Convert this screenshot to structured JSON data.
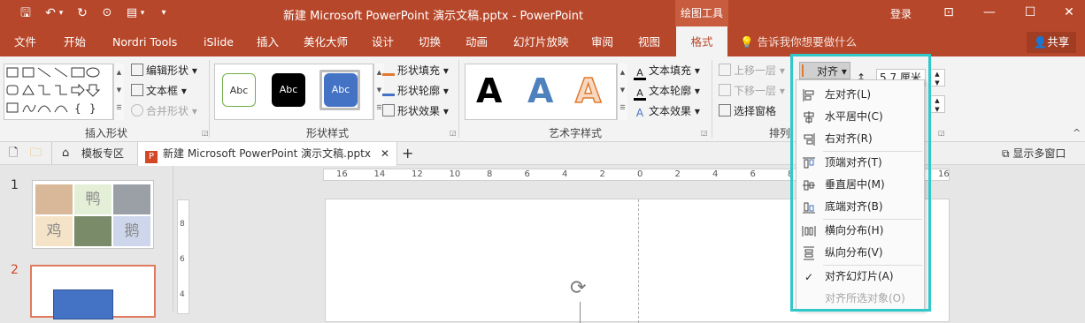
{
  "titlebar": {
    "doc_title": "新建 Microsoft PowerPoint 演示文稿.pptx  -  PowerPoint",
    "context_tab": "绘图工具",
    "login": "登录",
    "qat": {
      "save": "🖫",
      "undo": "↶",
      "redo": "↻",
      "more": "▾"
    }
  },
  "tabs": [
    "文件",
    "开始",
    "Nordri Tools",
    "iSlide",
    "插入",
    "美化大师",
    "设计",
    "切换",
    "动画",
    "幻灯片放映",
    "审阅",
    "视图",
    "格式"
  ],
  "tellme": "告诉我你想要做什么",
  "share": "共享",
  "ribbon": {
    "insert_shapes": {
      "edit_shape": "编辑形状",
      "textbox": "文本框",
      "merge_shapes": "合并形状",
      "label": "插入形状"
    },
    "shape_styles": {
      "styles": [
        "Abc",
        "Abc",
        "Abc"
      ],
      "fill": "形状填充",
      "outline": "形状轮廓",
      "effects": "形状效果",
      "label": "形状样式"
    },
    "wordart": {
      "glyphs": [
        "A",
        "A",
        "A"
      ],
      "fill": "文本填充",
      "outline": "文本轮廓",
      "effects": "文本效果",
      "label": "艺术字样式"
    },
    "arrange": {
      "bring_forward": "上移一层",
      "send_backward": "下移一层",
      "selection_pane": "选择窗格",
      "label": "排列",
      "align": "对齐",
      "size_value": "5.7 厘米"
    }
  },
  "docstrip": {
    "templates": "模板专区",
    "doc_tab": "新建 Microsoft PowerPoint 演示文稿.pptx",
    "show_multi": "显示多窗口"
  },
  "slides": {
    "numbers": [
      "1",
      "2"
    ],
    "thumb_cells": [
      "鸭",
      "鸡",
      "鹅"
    ]
  },
  "ruler": {
    "h_labels": [
      "16",
      "14",
      "12",
      "10",
      "8",
      "6",
      "4",
      "2",
      "0",
      "2",
      "4",
      "6",
      "8",
      "10",
      "12",
      "14",
      "16"
    ],
    "v_labels": [
      "8",
      "6",
      "4"
    ]
  },
  "align_menu": {
    "items": [
      {
        "label": "左对齐(L)",
        "icon": "align-left-icon"
      },
      {
        "label": "水平居中(C)",
        "icon": "align-center-icon"
      },
      {
        "label": "右对齐(R)",
        "icon": "align-right-icon"
      },
      {
        "label": "顶端对齐(T)",
        "icon": "align-top-icon"
      },
      {
        "label": "垂直居中(M)",
        "icon": "align-middle-icon"
      },
      {
        "label": "底端对齐(B)",
        "icon": "align-bottom-icon"
      },
      {
        "label": "横向分布(H)",
        "icon": "distribute-horizontal-icon"
      },
      {
        "label": "纵向分布(V)",
        "icon": "distribute-vertical-icon"
      },
      {
        "label": "对齐幻灯片(A)",
        "icon": "checkmark-icon"
      },
      {
        "label": "对齐所选对象(O)",
        "icon": ""
      }
    ]
  },
  "colors": {
    "accent": "#b7472a",
    "highlight": "#30c8c8",
    "shape_blue": "#4472c4"
  }
}
